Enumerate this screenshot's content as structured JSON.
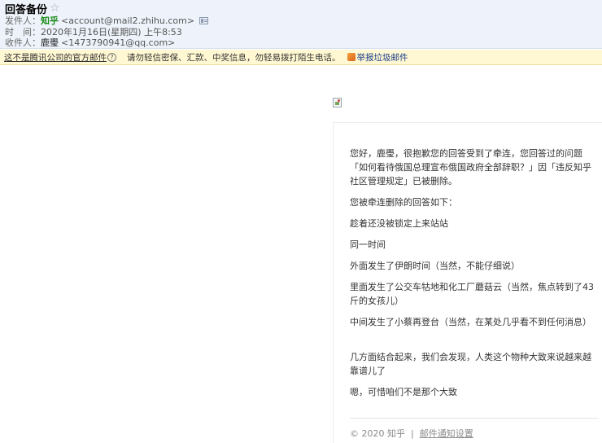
{
  "email": {
    "subject": "回答备份",
    "star_icon": "☆",
    "from_label": "发件人：",
    "from_name": "知乎",
    "from_addr": "<account@mail2.zhihu.com>",
    "time_label": "时　间：",
    "time_value": "2020年1月16日(星期四) 上午8:53",
    "to_label": "收件人：",
    "to_name": "鹿璺",
    "to_addr": "<1473790941@qq.com>"
  },
  "warning": {
    "not_official": "这不是腾讯公司的官方邮件",
    "help_glyph": "?",
    "tip": "请勿轻信密保、汇款、中奖信息，勿轻易拨打陌生电话。",
    "report": "举报垃圾邮件"
  },
  "body": {
    "greeting": "您好，鹿璺，很抱歉您的回答受到了牵连，您回答过的问题「如何看待俄国总理宣布俄国政府全部辞职？」因「违反知乎社区管理规定」已被删除。",
    "intro": "您被牵连删除的回答如下：",
    "lines": [
      "趁着还没被锁定上来站站",
      "同一时间",
      "外面发生了伊朗时间（当然，不能仔细说）",
      "里面发生了公交车牯地和化工厂蘑菇云（当然，焦点转到了43斤的女孩儿）",
      "中间发生了小蔡再登台（当然，在某处几乎看不到任何消息）"
    ],
    "conclusion_1": "几方面结合起来，我们会发现，人类这个物种大致来说越来越靠谱儿了",
    "conclusion_2": "嗯，可惜咱们不是那个大致"
  },
  "footer": {
    "copyright": "© 2020 知乎",
    "separator": "|",
    "settings_link": "邮件通知设置"
  }
}
